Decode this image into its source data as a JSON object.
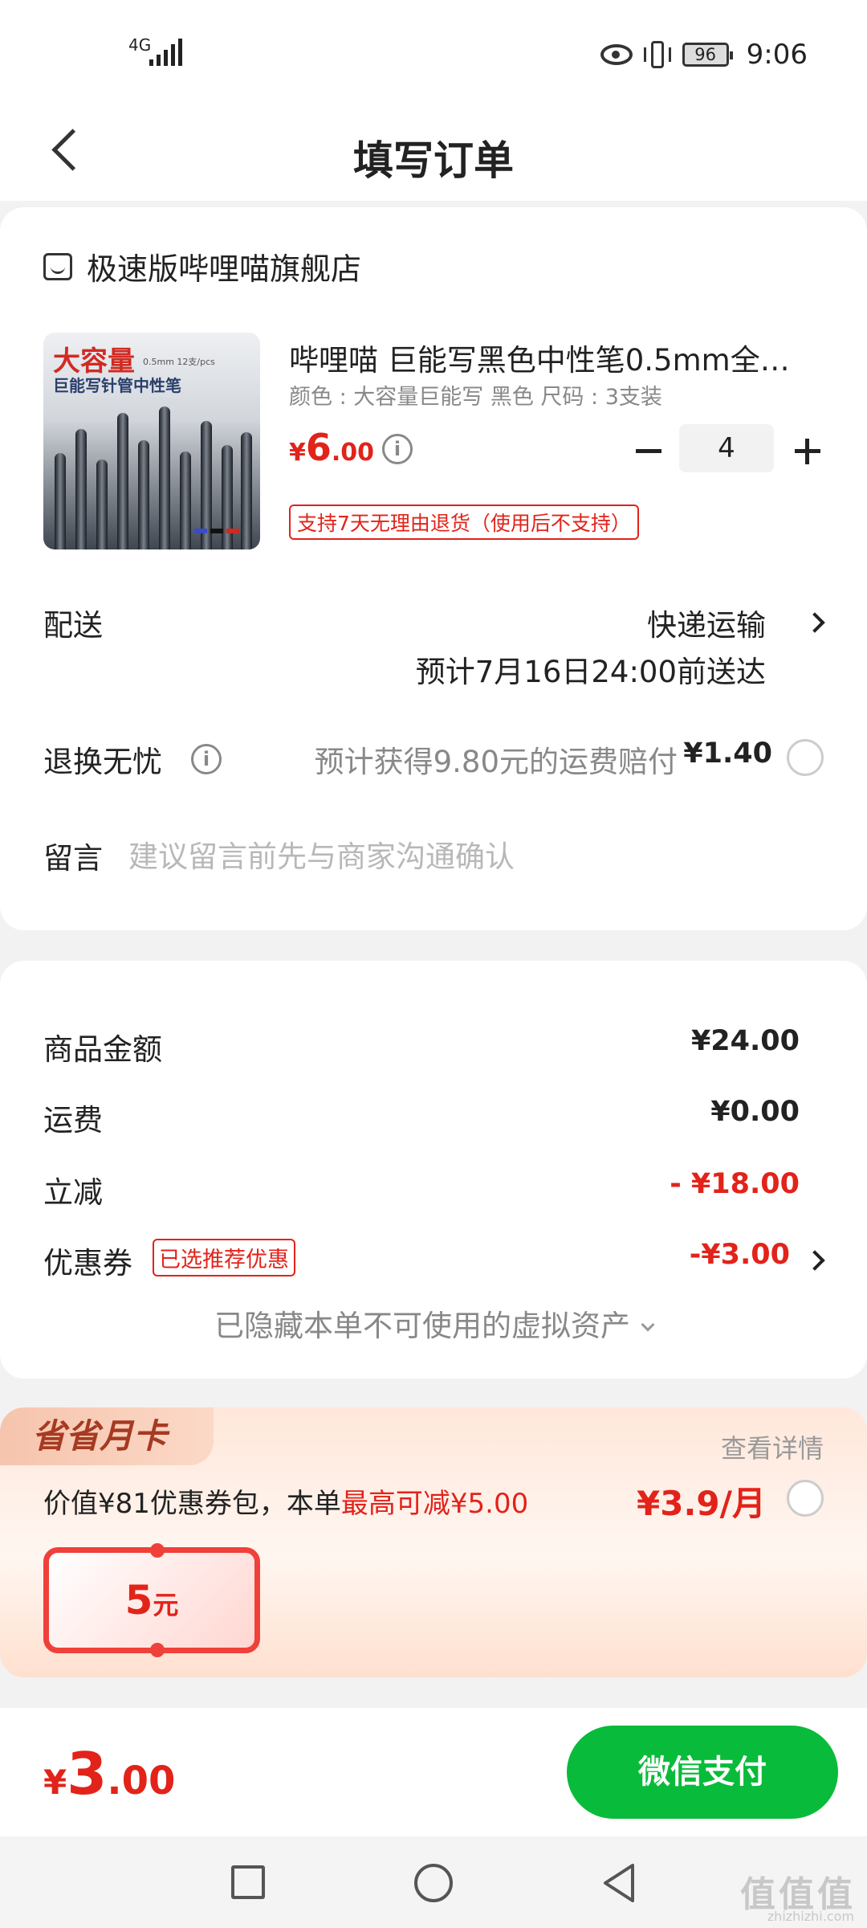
{
  "status_bar": {
    "network": "4G",
    "battery": "96",
    "time": "9:06"
  },
  "header": {
    "title": "填写订单"
  },
  "store": {
    "name": "极速版哔哩喵旗舰店"
  },
  "product": {
    "image_title": "大容量",
    "image_small": "0.5mm 12支/pcs",
    "image_subtitle": "巨能写针管中性笔",
    "title": "哔哩喵 巨能写黑色中性笔0.5mm全…",
    "spec": "颜色 : 大容量巨能写 黑色   尺码 : 3支装",
    "price_symbol": "¥",
    "price_int": "6",
    "price_dec": ".00",
    "quantity": "4",
    "return_badge": "支持7天无理由退货（使用后不支持）"
  },
  "delivery": {
    "label": "配送",
    "method": "快递运输",
    "eta": "预计7月16日24:00前送达"
  },
  "insurance": {
    "label": "退换无忧",
    "text": "预计获得9.80元的运费赔付",
    "price": "¥1.40"
  },
  "message": {
    "label": "留言",
    "placeholder": "建议留言前先与商家沟通确认"
  },
  "summary": {
    "goods_label": "商品金额",
    "goods_value": "¥24.00",
    "shipping_label": "运费",
    "shipping_value": "¥0.00",
    "discount_label": "立减",
    "discount_value": "- ¥18.00",
    "coupon_label": "优惠券",
    "coupon_badge": "已选推荐优惠",
    "coupon_value": "-¥3.00",
    "hidden_assets": "已隐藏本单不可使用的虚拟资产"
  },
  "month_card": {
    "tag": "省省月卡",
    "view_details": "查看详情",
    "desc_prefix": "价值¥81优惠券包，本单",
    "desc_highlight": "最高可减¥5.00",
    "price": "¥3.9/月",
    "coupon_amount": "5",
    "coupon_unit": "元"
  },
  "footer": {
    "total_symbol": "¥",
    "total_int": "3",
    "total_dec": ".00",
    "pay_button": "微信支付"
  },
  "watermark": {
    "text": "值值值",
    "sub": "zhizhizhi.com"
  },
  "colors": {
    "accent_red": "#e2231a",
    "wechat_green": "#09bb3a",
    "muted_gray": "#888888"
  },
  "icons": [
    "back-icon",
    "store-icon",
    "info-icon",
    "minus-icon",
    "plus-icon",
    "chevron-right-icon",
    "chevron-down-icon",
    "eye-icon",
    "vibrate-icon",
    "battery-icon",
    "signal-icon",
    "nav-recent-icon",
    "nav-home-icon",
    "nav-back-icon"
  ]
}
